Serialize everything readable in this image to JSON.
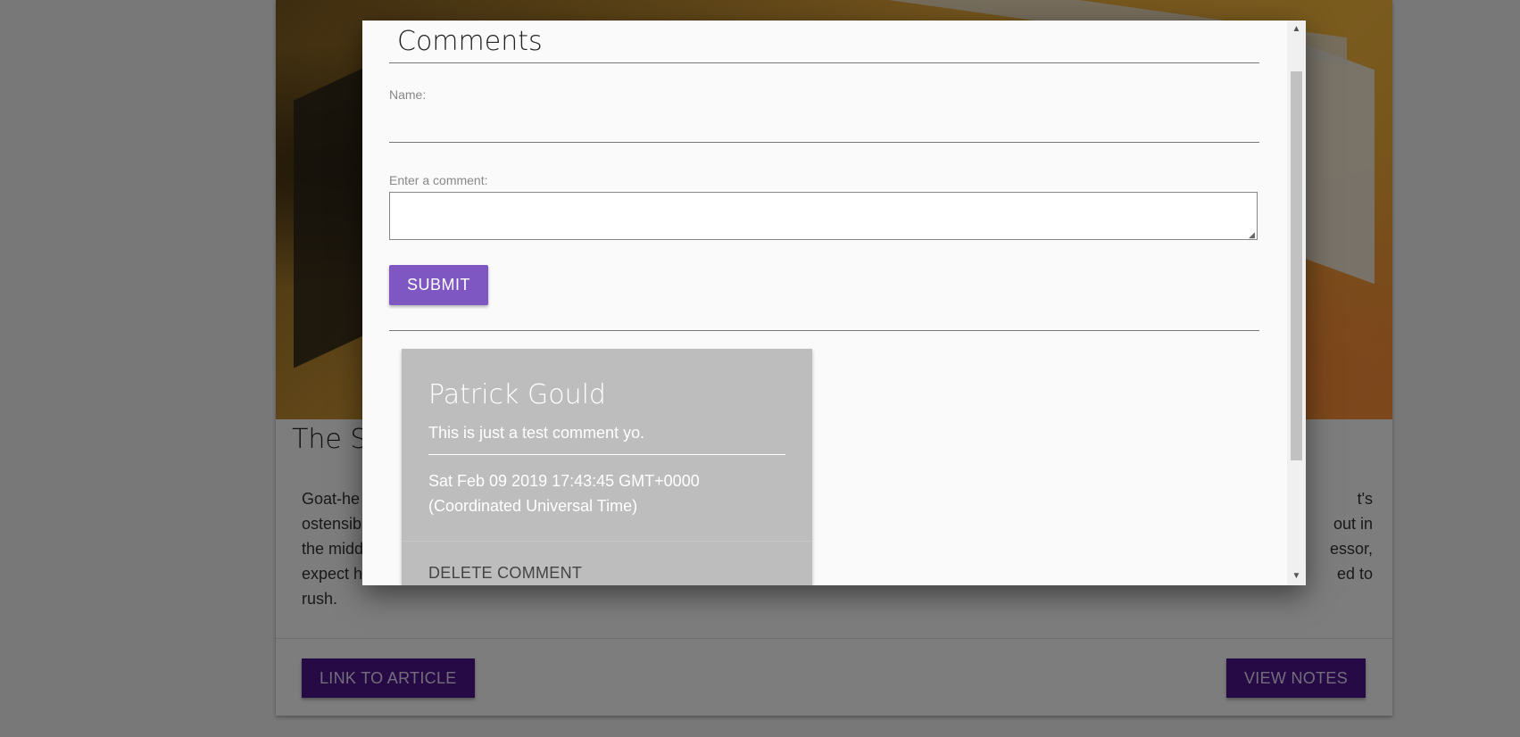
{
  "article": {
    "title_partial": "The St",
    "body_lines_left": [
      "Goat-he",
      "ostensib",
      "the midd",
      "expect h",
      "rush."
    ],
    "body_lines_right": [
      "t's",
      "out in",
      "essor,",
      "ed to"
    ],
    "link_button": "LINK TO ARTICLE",
    "notes_button": "VIEW NOTES"
  },
  "modal": {
    "title": "Comments",
    "name_label": "Name:",
    "name_value": "",
    "comment_label": "Enter a comment:",
    "comment_value": "",
    "submit_label": "SUBMIT",
    "comments": [
      {
        "author": "Patrick Gould",
        "text": "This is just a test comment yo.",
        "date_line1": "Sat Feb 09 2019 17:43:45 GMT+0000",
        "date_line2": "(Coordinated Universal Time)",
        "delete_label": "DELETE COMMENT"
      }
    ]
  },
  "icons": {
    "scroll_up": "triangle-up",
    "scroll_down": "triangle-down",
    "resize": "resize-grip"
  },
  "colors": {
    "submit_bg": "#7e57c2",
    "article_button_bg": "#4a148c",
    "comment_card_bg": "#bdbdbd",
    "overlay": "rgba(0,0,0,0.5)"
  }
}
